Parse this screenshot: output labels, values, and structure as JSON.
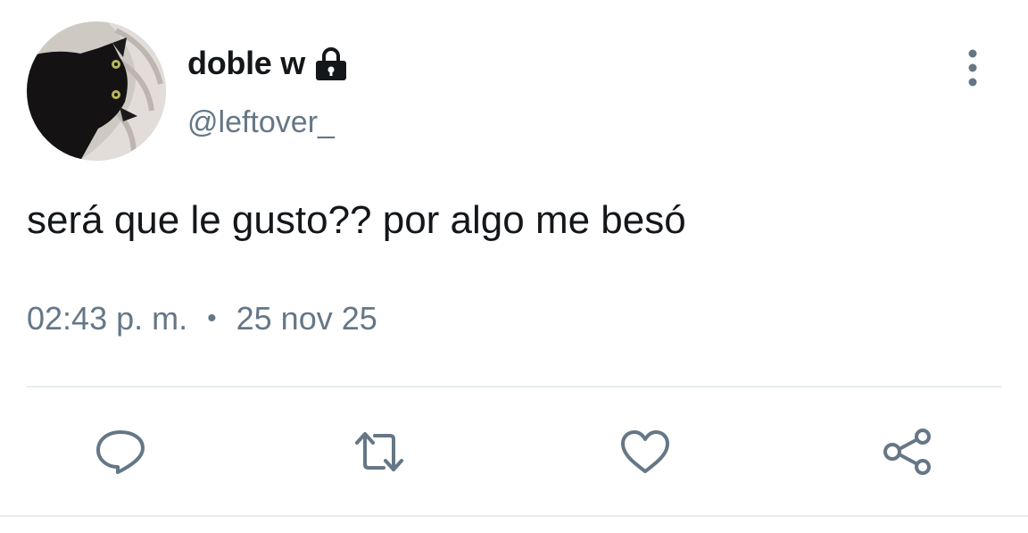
{
  "user": {
    "display_name": "doble w",
    "handle": "@leftover_",
    "protected_icon": "lock-icon",
    "avatar_icon": "avatar-black-cat"
  },
  "tweet": {
    "text": "será que le gusto?? por algo me besó",
    "time": "02:43 p. m.",
    "separator": "•",
    "date": "25 nov 25"
  },
  "actions": {
    "reply_icon": "reply-icon",
    "retweet_icon": "retweet-icon",
    "like_icon": "heart-icon",
    "share_icon": "share-icon",
    "more_icon": "more-vertical-icon"
  },
  "colors": {
    "text_primary": "#14171a",
    "text_secondary": "#657786",
    "divider": "#e6ecf0"
  }
}
